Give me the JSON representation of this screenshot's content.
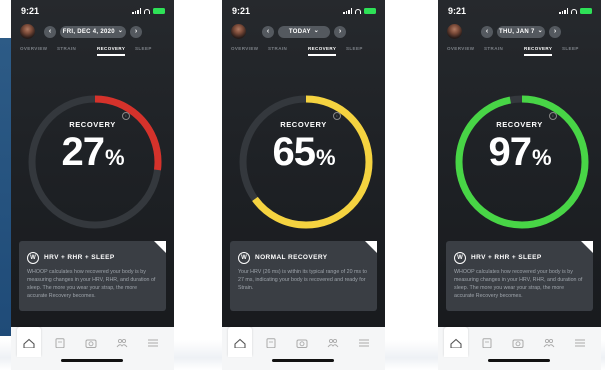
{
  "colors": {
    "red": "#d5322b",
    "yellow": "#f5d340",
    "green": "#48d546",
    "track": "#34383d"
  },
  "phones": [
    {
      "time": "9:21",
      "date": "FRI, DEC 4, 2020",
      "date_chevron": "⌄",
      "tabs": [
        "OVERVIEW",
        "STRAIN",
        "RECOVERY",
        "SLEEP"
      ],
      "active_tab": "RECOVERY",
      "ring_label": "RECOVERY",
      "value": "27",
      "pct": "%",
      "progress": 0.27,
      "ring_color": "red",
      "card_title": "HRV + RHR + SLEEP",
      "card_text": "WHOOP calculates how recovered your body is by measuring changes in your HRV, RHR, and duration of sleep. The more you wear your strap, the more accurate Recovery becomes."
    },
    {
      "time": "9:21",
      "date": "TODAY",
      "date_chevron": "⌄",
      "tabs": [
        "OVERVIEW",
        "STRAIN",
        "RECOVERY",
        "SLEEP"
      ],
      "active_tab": "RECOVERY",
      "ring_label": "RECOVERY",
      "value": "65",
      "pct": "%",
      "progress": 0.65,
      "ring_color": "yellow",
      "card_title": "NORMAL RECOVERY",
      "card_text": "Your HRV (26 ms) is within its typical range of 20 ms to 27 ms, indicating your body is recovered and ready for Strain."
    },
    {
      "time": "9:21",
      "date": "THU, JAN 7",
      "date_chevron": "⌄",
      "tabs": [
        "OVERVIEW",
        "STRAIN",
        "RECOVERY",
        "SLEEP"
      ],
      "active_tab": "RECOVERY",
      "ring_label": "RECOVERY",
      "value": "97",
      "pct": "%",
      "progress": 0.97,
      "ring_color": "green",
      "card_title": "HRV + RHR + SLEEP",
      "card_text": "WHOOP calculates how recovered your body is by measuring changes in your HRV, RHR, and duration of sleep. The more you wear your strap, the more accurate Recovery becomes."
    }
  ],
  "icons": {
    "avatar": "profile-avatar",
    "prev": "chevron-left-icon",
    "next": "chevron-right-icon",
    "info": "info-icon",
    "card": "whoop-logo-icon",
    "nav": [
      "home-icon",
      "journal-icon",
      "camera-icon",
      "community-icon",
      "menu-icon"
    ]
  }
}
